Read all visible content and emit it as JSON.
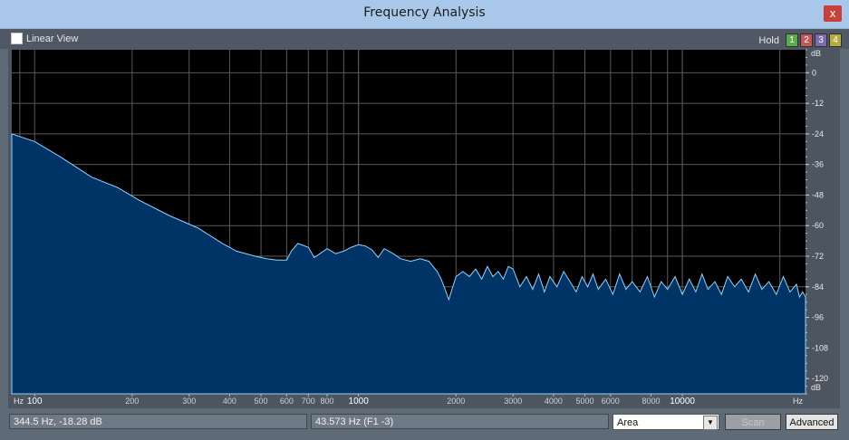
{
  "window": {
    "title": "Frequency Analysis",
    "close_label": "x"
  },
  "toolbar": {
    "linear_view_label": "Linear View",
    "hold_label": "Hold",
    "hold_buttons": [
      {
        "label": "1",
        "color": "#5cab4b"
      },
      {
        "label": "2",
        "color": "#c45858"
      },
      {
        "label": "3",
        "color": "#7c6bb0"
      },
      {
        "label": "4",
        "color": "#b8ab3d"
      }
    ]
  },
  "chart_data": {
    "type": "area",
    "x_scale": "log",
    "xlim": [
      85,
      24000
    ],
    "ylim": [
      -126,
      9
    ],
    "y_unit": "dB",
    "x_unit": "Hz",
    "y_ticks": [
      "0",
      "-12",
      "-24",
      "-36",
      "-48",
      "-60",
      "-72",
      "-84",
      "-96",
      "-108",
      "-120"
    ],
    "x_ticks": [
      {
        "label": "100",
        "value": 100,
        "major": true
      },
      {
        "label": "200",
        "value": 200,
        "major": false
      },
      {
        "label": "300",
        "value": 300,
        "major": false
      },
      {
        "label": "400",
        "value": 400,
        "major": false
      },
      {
        "label": "500",
        "value": 500,
        "major": false
      },
      {
        "label": "600",
        "value": 600,
        "major": false
      },
      {
        "label": "700",
        "value": 700,
        "major": false
      },
      {
        "label": "800",
        "value": 800,
        "major": false
      },
      {
        "label": "1000",
        "value": 1000,
        "major": true
      },
      {
        "label": "2000",
        "value": 2000,
        "major": false
      },
      {
        "label": "3000",
        "value": 3000,
        "major": false
      },
      {
        "label": "4000",
        "value": 4000,
        "major": false
      },
      {
        "label": "5000",
        "value": 5000,
        "major": false
      },
      {
        "label": "6000",
        "value": 6000,
        "major": false
      },
      {
        "label": "8000",
        "value": 8000,
        "major": false
      },
      {
        "label": "10000",
        "value": 10000,
        "major": true
      }
    ],
    "fill_color": "#003366",
    "line_color": "#8fd3ff",
    "series": [
      {
        "x": [
          85,
          100,
          120,
          150,
          180,
          210,
          260,
          320,
          380,
          420,
          480,
          520,
          560,
          600,
          620,
          650,
          700,
          730,
          760,
          800,
          850,
          900,
          950,
          1000,
          1050,
          1100,
          1150,
          1200,
          1280,
          1350,
          1450,
          1550,
          1650,
          1750,
          1800,
          1850,
          1900,
          2000,
          2100,
          2200,
          2300,
          2400,
          2500,
          2600,
          2700,
          2800,
          2900,
          3000,
          3150,
          3300,
          3450,
          3600,
          3750,
          3900,
          4100,
          4300,
          4500,
          4700,
          4900,
          5100,
          5300,
          5500,
          5800,
          6100,
          6400,
          6700,
          7000,
          7400,
          7800,
          8200,
          8600,
          9000,
          9500,
          10000,
          10500,
          11000,
          11500,
          12000,
          12600,
          13200,
          13800,
          14500,
          15200,
          16000,
          16800,
          17600,
          18500,
          19500,
          20500,
          21500,
          22500,
          23000,
          23500,
          24000
        ],
        "y": [
          -24,
          -27,
          -33,
          -41,
          -45,
          -50,
          -56,
          -61,
          -67,
          -70,
          -72,
          -73,
          -73.5,
          -73.5,
          -70,
          -67,
          -68.5,
          -72.5,
          -71,
          -69,
          -71,
          -70,
          -68.5,
          -67.5,
          -68,
          -69.5,
          -72.5,
          -69,
          -71,
          -73,
          -74,
          -73,
          -74,
          -78,
          -81,
          -85,
          -89,
          -80,
          -78,
          -80,
          -77,
          -81,
          -76,
          -80,
          -78,
          -81,
          -76,
          -77,
          -84,
          -80,
          -85,
          -79,
          -86,
          -80,
          -84,
          -78,
          -82,
          -86,
          -80,
          -84,
          -79,
          -85,
          -81,
          -87,
          -79,
          -85,
          -82,
          -86,
          -80,
          -88,
          -82,
          -85,
          -80,
          -87,
          -81,
          -86,
          -79,
          -85,
          -82,
          -87,
          -80,
          -84,
          -81,
          -86,
          -79,
          -85,
          -82,
          -87,
          -80,
          -86,
          -83,
          -88,
          -86,
          -88
        ]
      }
    ]
  },
  "status": {
    "cursor_readout": "344.5 Hz, -18.28 dB",
    "peak_readout": "43.573 Hz (F1 -3)",
    "display_mode": "Area",
    "scan_label": "Scan",
    "advanced_label": "Advanced"
  }
}
